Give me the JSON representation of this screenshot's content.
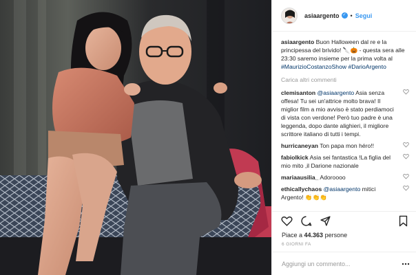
{
  "post": {
    "username": "asiaargento",
    "follow_label": "Segui",
    "separator": "•",
    "verified_glyph": "✓"
  },
  "caption": {
    "username": "asiaargento",
    "text_start": "Buon Halloween dal re e la principessa del brivido! ",
    "emoji": "🔪🎃",
    "text_middle": " - questa sera alle 23:30 saremo insieme per la prima volta al ",
    "hashtag1": "#MaurizioCostanzoShow",
    "hashtag2": "#DarioArgento"
  },
  "load_more_label": "Carica altri commenti",
  "comments": [
    {
      "user": "clemisanton",
      "mention": "@asiaargento",
      "text": " Asia senza offesa! Tu sei un'attrice molto brava! Il miglior film a mio avviso è stato perdiamoci di vista con verdone! Però tuo padre è una leggenda, dopo dante alighieri, il migliore scrittore italiano di tutti i tempi."
    },
    {
      "user": "hurricaneyan",
      "mention": "",
      "text": " Ton papa mon héro!!"
    },
    {
      "user": "fabiolkick",
      "mention": "",
      "text": " Asia sei fantastica !La figlia del mio mito ,il Darione nazionale"
    },
    {
      "user": "mariaausilia_",
      "mention": "",
      "text": " Adoroooo"
    },
    {
      "user": "ethicallychaos",
      "mention": "@asiaargento",
      "text": " mitici Argento! 👏👏👏"
    }
  ],
  "likes": {
    "prefix": "Piace a ",
    "count": "44.363",
    "suffix": " persone"
  },
  "date_label": "6 GIORNI FA",
  "add_comment": {
    "placeholder": "Aggiungi un commento..."
  },
  "icons": {
    "like": "heart-icon",
    "comment": "comment-icon",
    "share": "share-icon",
    "save": "bookmark-icon",
    "more": "more-options-icon"
  },
  "colors": {
    "link": "#003569",
    "follow": "#3897f0",
    "muted": "#999999",
    "border": "#efefef"
  }
}
